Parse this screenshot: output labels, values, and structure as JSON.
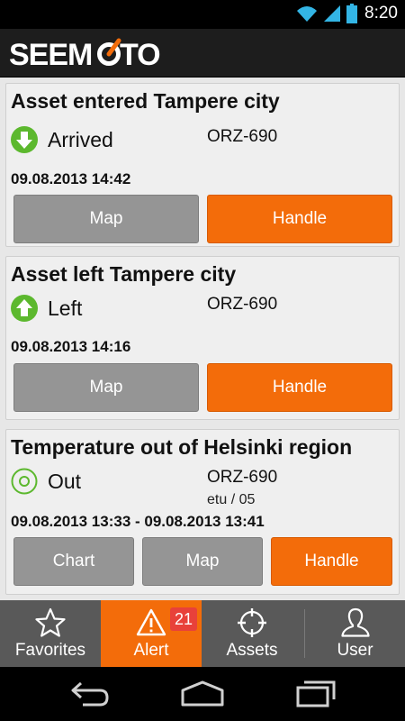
{
  "status_bar": {
    "time": "8:20"
  },
  "app": {
    "logo_text": "SEEMOTO"
  },
  "alerts": [
    {
      "title": "Asset entered Tampere city",
      "status": "Arrived",
      "status_icon": "arrow-down-icon",
      "plate": "ORZ-690",
      "subinfo": "",
      "timestamp": "09.08.2013 14:42",
      "buttons": [
        "Map",
        "Handle"
      ]
    },
    {
      "title": "Asset left Tampere city",
      "status": "Left",
      "status_icon": "arrow-up-icon",
      "plate": "ORZ-690",
      "subinfo": "",
      "timestamp": "09.08.2013 14:16",
      "buttons": [
        "Map",
        "Handle"
      ]
    },
    {
      "title": "Temperature out of Helsinki region",
      "status": "Out",
      "status_icon": "ring-icon",
      "plate": "ORZ-690",
      "subinfo": "etu / 05",
      "timestamp": "09.08.2013 13:33 - 09.08.2013 13:41",
      "buttons": [
        "Chart",
        "Map",
        "Handle"
      ]
    }
  ],
  "tabs": [
    {
      "label": "Favorites",
      "icon": "star-icon",
      "active": false
    },
    {
      "label": "Alert",
      "icon": "warning-icon",
      "active": true,
      "badge": "21"
    },
    {
      "label": "Assets",
      "icon": "crosshair-icon",
      "active": false
    },
    {
      "label": "User",
      "icon": "user-icon",
      "active": false
    }
  ],
  "colors": {
    "accent": "#f36c0a",
    "badge": "#e8413a",
    "status_green": "#5cb82e",
    "button_gray": "#959595"
  }
}
